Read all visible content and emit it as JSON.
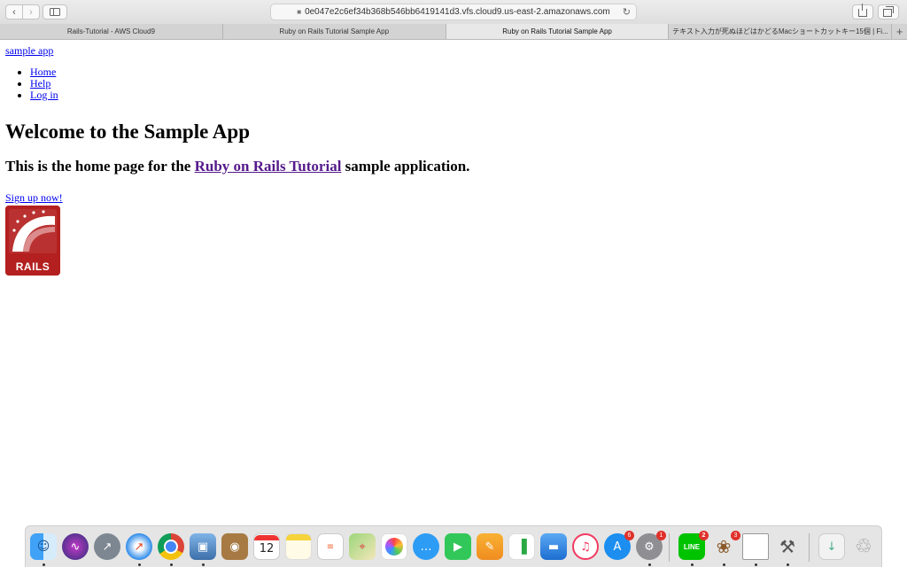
{
  "browser": {
    "url": "0e047e2c6ef34b368b546bb6419141d3.vfs.cloud9.us-east-2.amazonaws.com",
    "tabs": [
      {
        "title": "Rails-Tutorial - AWS Cloud9",
        "active": false
      },
      {
        "title": "Ruby on Rails Tutorial Sample App",
        "active": false
      },
      {
        "title": "Ruby on Rails Tutorial Sample App",
        "active": true
      },
      {
        "title": "テキスト入力が死ぬほどはかどるMacショートカットキー15個 | Fi...",
        "active": false
      }
    ]
  },
  "page": {
    "logo_link": "sample app",
    "nav": [
      "Home",
      "Help",
      "Log in"
    ],
    "heading": "Welcome to the Sample App",
    "subheading_before": "This is the home page for the ",
    "subheading_link": "Ruby on Rails Tutorial",
    "subheading_after": " sample application.",
    "signup_link": "Sign up now!",
    "logo_text": "RAILS"
  },
  "dock": {
    "items": [
      {
        "name": "finder-icon",
        "running": true
      },
      {
        "name": "siri-icon",
        "running": false
      },
      {
        "name": "launchpad-icon",
        "running": false
      },
      {
        "name": "safari-icon",
        "running": true
      },
      {
        "name": "chrome-icon",
        "running": true
      },
      {
        "name": "preview-icon",
        "running": true
      },
      {
        "name": "contacts-icon",
        "running": false
      },
      {
        "name": "calendar-icon",
        "running": false,
        "label": "12"
      },
      {
        "name": "notes-icon",
        "running": false
      },
      {
        "name": "reminders-icon",
        "running": false
      },
      {
        "name": "maps-icon",
        "running": false
      },
      {
        "name": "photos-icon",
        "running": false
      },
      {
        "name": "messages-icon",
        "running": false
      },
      {
        "name": "facetime-icon",
        "running": false
      },
      {
        "name": "pages-icon",
        "running": false
      },
      {
        "name": "numbers-icon",
        "running": false
      },
      {
        "name": "keynote-icon",
        "running": false
      },
      {
        "name": "music-icon",
        "running": false
      },
      {
        "name": "app-store-icon",
        "running": false,
        "badge": "6"
      },
      {
        "name": "system-preferences-icon",
        "running": true,
        "badge": "1"
      },
      {
        "name": "line-icon",
        "running": true,
        "badge": "2",
        "label": "LINE"
      },
      {
        "name": "owl-app-icon",
        "running": true,
        "badge": "3"
      },
      {
        "name": "textedit-icon",
        "running": true
      },
      {
        "name": "utilities-icon",
        "running": true
      },
      {
        "name": "downloads-stack-icon",
        "running": false
      },
      {
        "name": "trash-icon",
        "running": false
      }
    ]
  }
}
